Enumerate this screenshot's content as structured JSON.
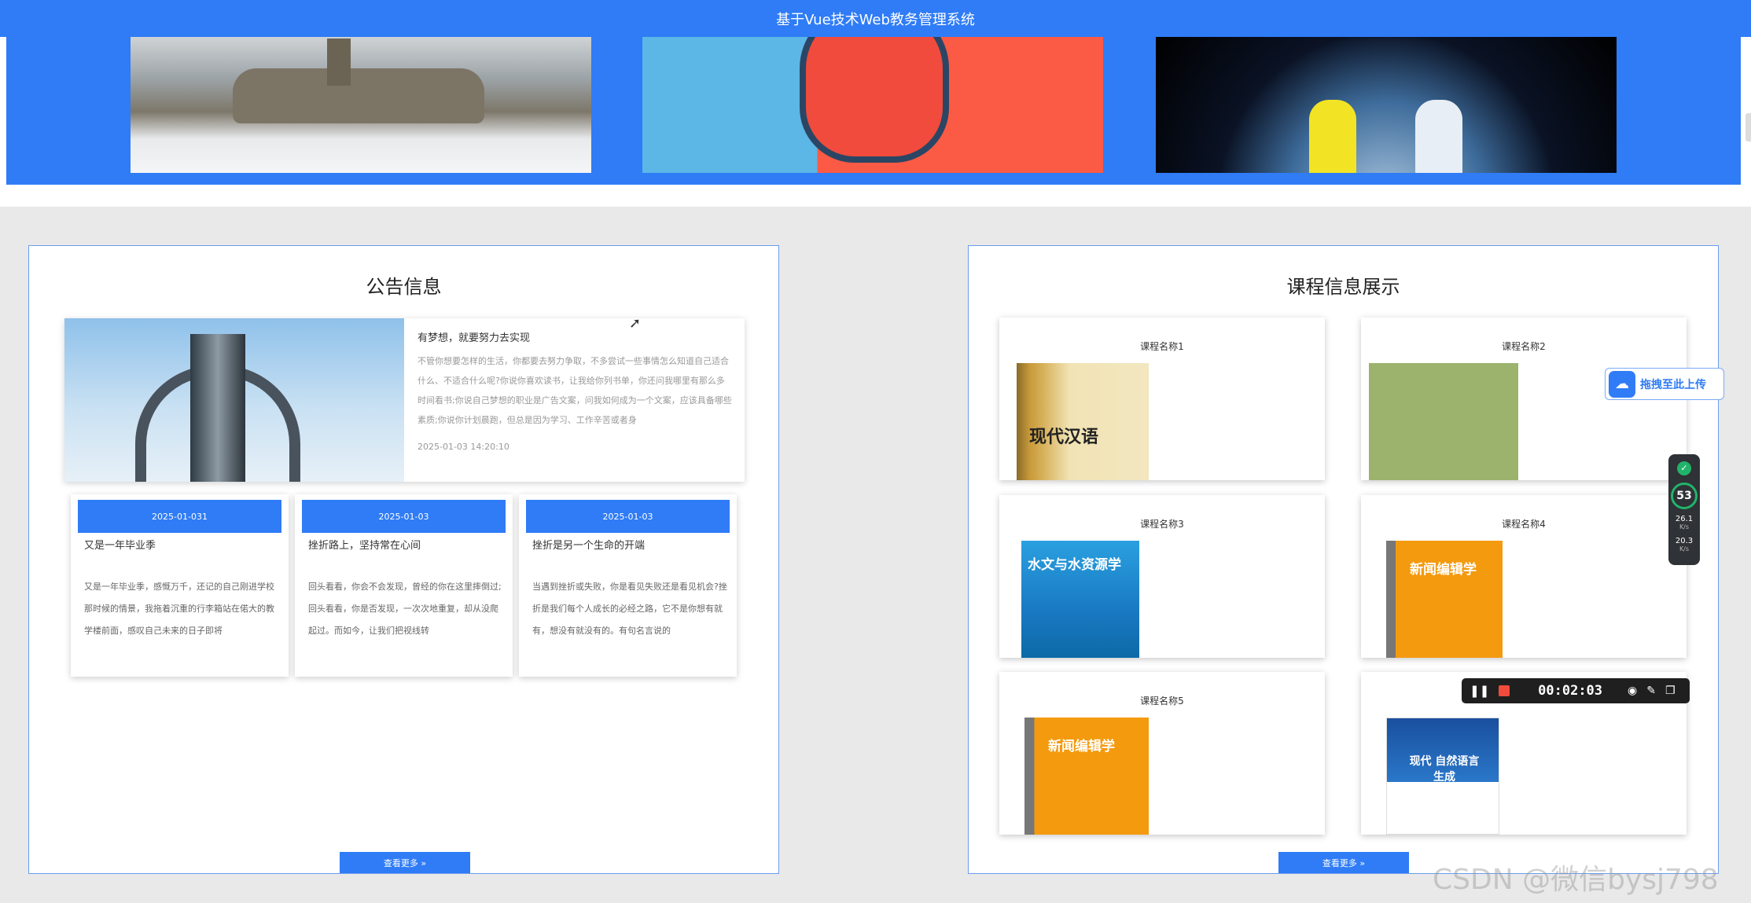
{
  "header": {
    "title": "基于Vue技术Web教务管理系统"
  },
  "banner": {
    "slides": [
      "castle-in-fog",
      "game-controller",
      "earth-and-astronauts"
    ]
  },
  "announcements": {
    "title": "公告信息",
    "featured": {
      "title": "有梦想，就要努力去实现",
      "text": "不管你想要怎样的生活，你都要去努力争取，不多尝试一些事情怎么知道自己适合什么、不适合什么呢?你说你喜欢读书，让我给你列书单，你还问我哪里有那么多时间看书;你说自己梦想的职业是广告文案，问我如何成为一个文案，应该具备哪些素质;你说你计划晨跑，但总是因为学习、工作辛苦或者身",
      "date": "2025-01-03 14:20:10"
    },
    "cards": [
      {
        "date": "2025-01-031",
        "title": "又是一年毕业季",
        "text": "又是一年毕业季，感慨万千，还记的自己刚进学校那时候的情景，我拖着沉重的行李箱站在偌大的教学楼前面，感叹自己未来的日子即将"
      },
      {
        "date": "2025-01-03",
        "title": "挫折路上，坚持常在心间",
        "text": "回头看看，你会不会发现，曾经的你在这里摔倒过;回头看看，你是否发现，一次次地重复，却从没爬起过。而如今，让我们把视线转"
      },
      {
        "date": "2025-01-03",
        "title": "挫折是另一个生命的开端",
        "text": "当遇到挫折或失败，你是看见失败还是看见机会?挫折是我们每个人成长的必经之路，它不是你想有就有，想没有就没有的。有句名言说的"
      }
    ],
    "more_label": "查看更多 »"
  },
  "courses": {
    "title": "课程信息展示",
    "items": [
      {
        "name": "课程名称1",
        "cover_text": "现代汉语"
      },
      {
        "name": "课程名称2",
        "cover_text": ""
      },
      {
        "name": "课程名称3",
        "cover_text": "水文与水资源学"
      },
      {
        "name": "课程名称4",
        "cover_text": "新闻编辑学"
      },
      {
        "name": "课程名称5",
        "cover_text": "新闻编辑学"
      },
      {
        "name": "",
        "cover_text": "现代 自然语言生成"
      }
    ],
    "more_label": "查看更多 »"
  },
  "overlays": {
    "upload_label": "拖拽至此上传",
    "meter": {
      "value": "53",
      "up": "26.1",
      "down": "20.3",
      "unit": "K/s"
    },
    "recorder": {
      "time": "00:02:03"
    },
    "watermark": "CSDN @微信bysj798"
  },
  "colors": {
    "primary": "#2f7cf6",
    "record": "#f04b3d",
    "ok": "#21b36a"
  }
}
